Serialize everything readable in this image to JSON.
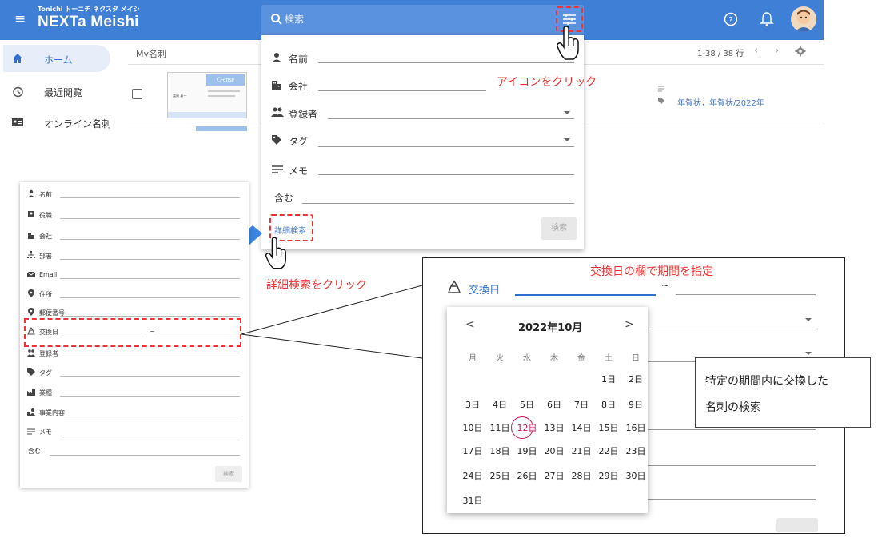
{
  "header": {
    "logo_top": "Tonichi トーニチ ネクスタ メイシ",
    "logo_main": "NEXTa Meishi",
    "search_placeholder": "検索"
  },
  "sidebar": {
    "items": [
      {
        "label": "ホーム",
        "icon": "home-icon"
      },
      {
        "label": "最近閲覧",
        "icon": "history-icon"
      },
      {
        "label": "オンライン名刺",
        "icon": "card-icon"
      }
    ]
  },
  "list": {
    "title": "My名刺",
    "row_count": "1-38 / 38 行",
    "tags": "年賀状，年賀状/2022年",
    "card_brand": "C-ense",
    "card_name": "富岡 真一"
  },
  "search_panel": {
    "fields": [
      {
        "label": "名前",
        "icon": "person-icon"
      },
      {
        "label": "会社",
        "icon": "building-icon"
      },
      {
        "label": "登録者",
        "icon": "group-icon"
      },
      {
        "label": "タグ",
        "icon": "tag-icon"
      },
      {
        "label": "メモ",
        "icon": "notes-icon"
      },
      {
        "label": "含む",
        "icon": ""
      }
    ],
    "detail_link": "詳細検索",
    "search_button": "検索"
  },
  "annotations": {
    "click_icon": "アイコンをクリック",
    "click_detail": "詳細検索をクリック",
    "exchange_period": "交換日の欄で期間を指定",
    "note_line1": "特定の期間内に交換した",
    "note_line2": "名刺の検索"
  },
  "detail_panel": {
    "fields": [
      "名前",
      "役職",
      "会社",
      "部署",
      "Email",
      "住所",
      "郵便番号",
      "交換日",
      "登録者",
      "タグ",
      "業種",
      "事業内容",
      "メモ",
      "含む"
    ],
    "range_sep": "~",
    "search_button": "検索"
  },
  "zoom": {
    "exchange_label": "交換日",
    "range_sep": "~",
    "calendar": {
      "month_title": "2022年10月",
      "dow": [
        "月",
        "火",
        "水",
        "木",
        "金",
        "土",
        "日"
      ],
      "weeks": [
        [
          "",
          "",
          "",
          "",
          "",
          "1日",
          "2日"
        ],
        [
          "3日",
          "4日",
          "5日",
          "6日",
          "7日",
          "8日",
          "9日"
        ],
        [
          "10日",
          "11日",
          "12日",
          "13日",
          "14日",
          "15日",
          "16日"
        ],
        [
          "17日",
          "18日",
          "19日",
          "20日",
          "21日",
          "22日",
          "23日"
        ],
        [
          "24日",
          "25日",
          "26日",
          "27日",
          "28日",
          "29日",
          "30日"
        ],
        [
          "31日",
          "",
          "",
          "",
          "",
          "",
          ""
        ]
      ],
      "today": "12日",
      "prev": "<",
      "next": ">"
    }
  },
  "colors": {
    "appbar": "#3f7fd6",
    "accent": "#4a7cc7",
    "annotation": "#e33",
    "today_ring": "#c2185b"
  }
}
